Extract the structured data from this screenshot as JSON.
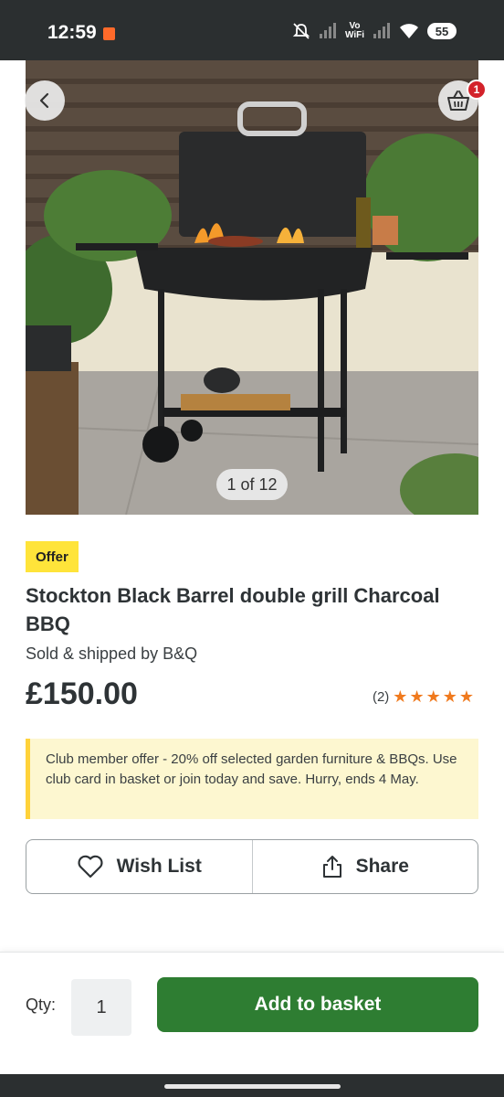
{
  "status_bar": {
    "time": "12:59",
    "network_label_top": "Vo",
    "network_label_bottom": "WiFi",
    "battery": "55"
  },
  "gallery": {
    "counter": "1 of 12",
    "basket_count": "1"
  },
  "product": {
    "badge": "Offer",
    "title": "Stockton Black Barrel double grill Charcoal BBQ",
    "seller": "Sold & shipped by B&Q",
    "price": "£150.00",
    "review_count": "(2)",
    "rating": 5,
    "rating_max": 5
  },
  "club_offer": {
    "text": "Club member offer - 20% off selected garden furniture & BBQs. Use club card in basket or join today and save. Hurry, ends 4 May."
  },
  "actions": {
    "wishlist_label": "Wish List",
    "share_label": "Share"
  },
  "purchase": {
    "qty_label": "Qty:",
    "qty_value": "1",
    "add_label": "Add to basket"
  },
  "colors": {
    "accent_green": "#2e7d32",
    "offer_yellow": "#ffe43a",
    "star_orange": "#f07a1e",
    "badge_red": "#d3222a"
  },
  "icons": [
    "back-chevron-icon",
    "basket-icon",
    "heart-icon",
    "share-icon",
    "star-icon"
  ]
}
